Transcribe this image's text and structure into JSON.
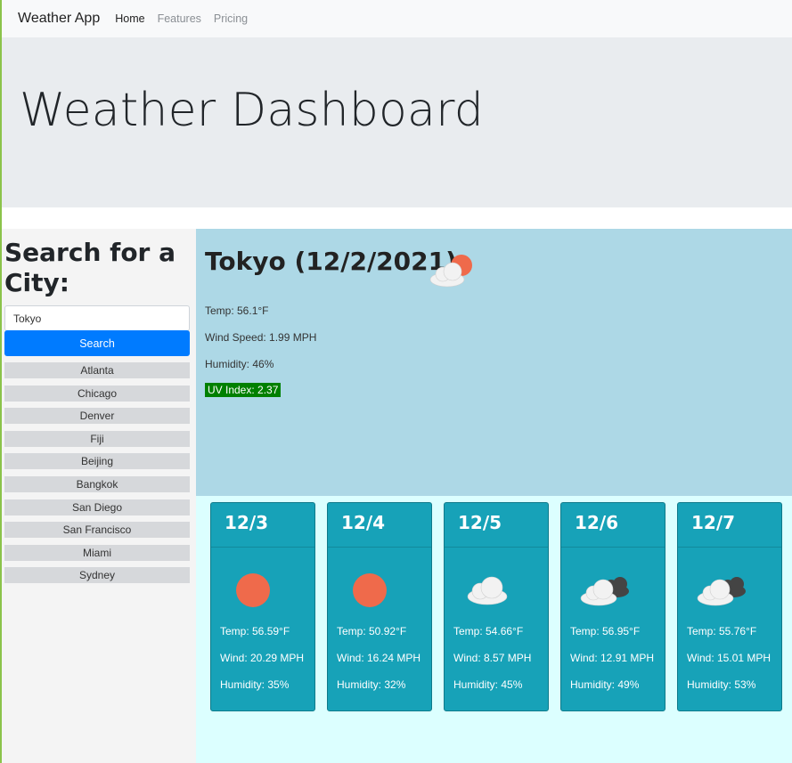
{
  "navbar": {
    "brand": "Weather App",
    "links": [
      {
        "label": "Home",
        "active": true
      },
      {
        "label": "Features",
        "active": false
      },
      {
        "label": "Pricing",
        "active": false
      }
    ]
  },
  "jumbotron": {
    "title": "Weather Dashboard"
  },
  "sidebar": {
    "heading": "Search for a City:",
    "search_value": "Tokyo",
    "search_button": "Search",
    "history": [
      "Atlanta",
      "Chicago",
      "Denver",
      "Fiji",
      "Beijing",
      "Bangkok",
      "San Diego",
      "San Francisco",
      "Miami",
      "Sydney"
    ]
  },
  "current": {
    "title": "Tokyo (12/2/2021)",
    "icon": "sun-cloud-icon",
    "temp": "Temp: 56.1°F",
    "wind": "Wind Speed: 1.99 MPH",
    "humidity": "Humidity: 46%",
    "uv": "UV Index: 2.37",
    "uv_color": "#008000"
  },
  "forecast": [
    {
      "date": "12/3",
      "icon": "sun-icon",
      "temp": "Temp: 56.59°F",
      "wind": "Wind: 20.29 MPH",
      "humidity": "Humidity: 35%"
    },
    {
      "date": "12/4",
      "icon": "sun-icon",
      "temp": "Temp: 50.92°F",
      "wind": "Wind: 16.24 MPH",
      "humidity": "Humidity: 32%"
    },
    {
      "date": "12/5",
      "icon": "cloud-icon",
      "temp": "Temp: 54.66°F",
      "wind": "Wind: 8.57 MPH",
      "humidity": "Humidity: 45%"
    },
    {
      "date": "12/6",
      "icon": "broken-clouds-icon",
      "temp": "Temp: 56.95°F",
      "wind": "Wind: 12.91 MPH",
      "humidity": "Humidity: 49%"
    },
    {
      "date": "12/7",
      "icon": "broken-clouds-icon",
      "temp": "Temp: 55.76°F",
      "wind": "Wind: 15.01 MPH",
      "humidity": "Humidity: 53%"
    }
  ],
  "colors": {
    "sun": "#ef6a4b",
    "cloud": "#f2f2f2",
    "dark_cloud": "#444444",
    "card": "#17a2b8",
    "current_bg": "#add8e6",
    "forecast_bg": "#dcffff",
    "button": "#007bff"
  }
}
